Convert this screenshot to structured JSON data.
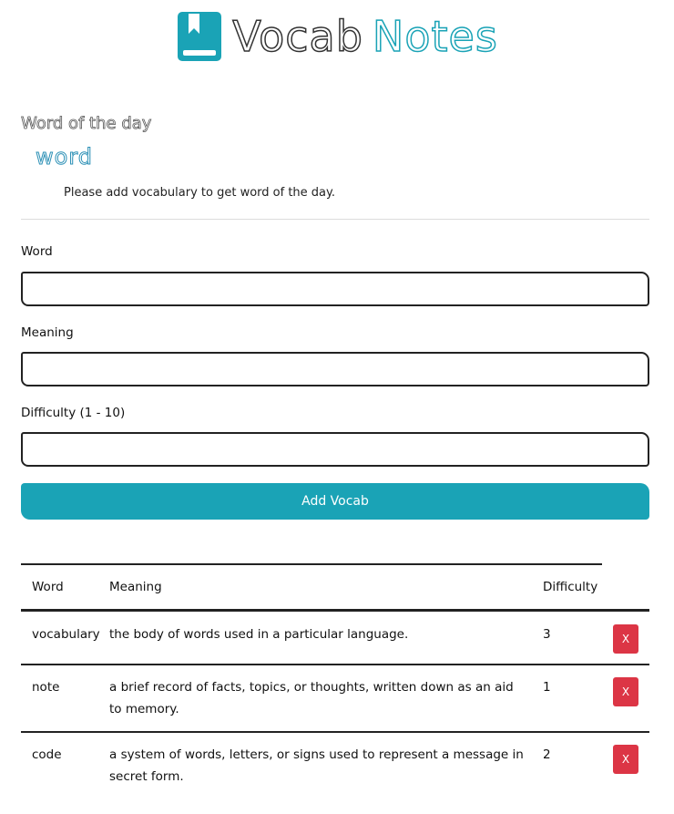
{
  "header": {
    "brand_part1": "Vocab",
    "brand_part2": "Notes",
    "logo_icon": "book-bookmark-icon",
    "accent_color": "#1aa3b6"
  },
  "word_of_the_day": {
    "heading": "Word of the day",
    "word": "word",
    "note": "Please add vocabulary to get word of the day."
  },
  "form": {
    "word_label": "Word",
    "word_value": "",
    "meaning_label": "Meaning",
    "meaning_value": "",
    "difficulty_label": "Difficulty (1 - 10)",
    "difficulty_value": "",
    "submit_label": "Add Vocab"
  },
  "table": {
    "headers": {
      "word": "Word",
      "meaning": "Meaning",
      "difficulty": "Difficulty"
    },
    "rows": [
      {
        "word": "vocabulary",
        "meaning": "the body of words used in a particular language.",
        "difficulty": "3",
        "delete_label": "X"
      },
      {
        "word": "note",
        "meaning": "a brief record of facts, topics, or thoughts, written down as an aid to memory.",
        "difficulty": "1",
        "delete_label": "X"
      },
      {
        "word": "code",
        "meaning": "a system of words, letters, or signs used to represent a message in secret form.",
        "difficulty": "2",
        "delete_label": "X"
      }
    ],
    "delete_color": "#dc3545"
  }
}
